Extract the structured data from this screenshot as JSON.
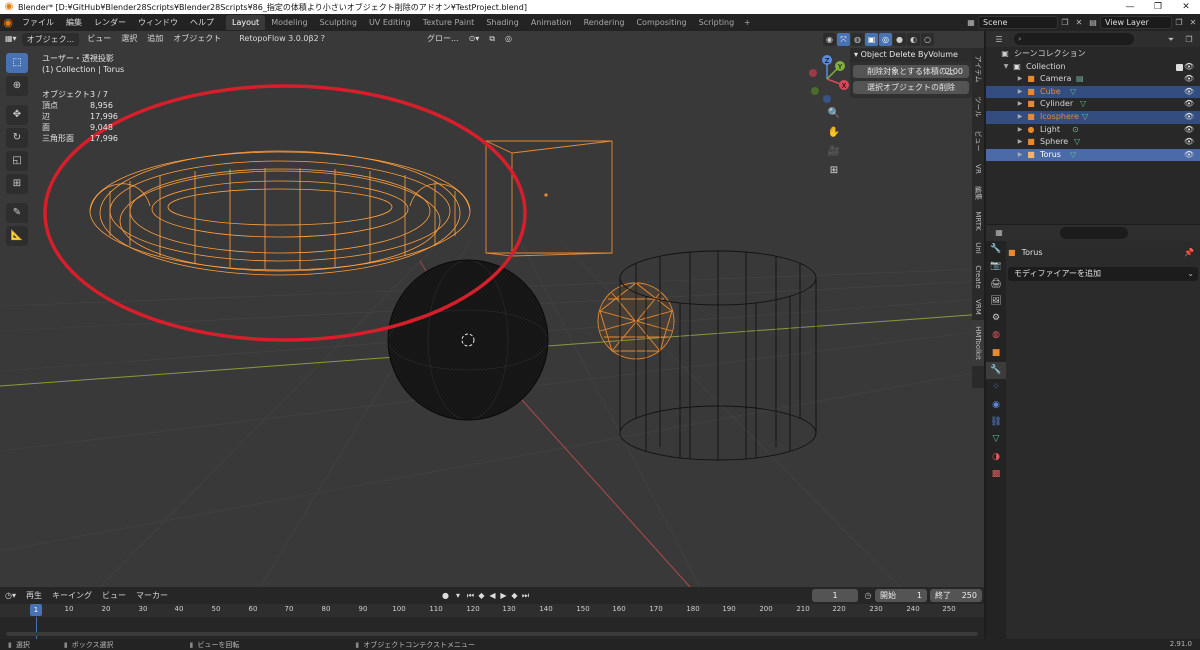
{
  "titlebar": {
    "title": "Blender* [D:¥GitHub¥Blender28Scripts¥Blender28Scripts¥86_指定の体積より小さいオブジェクト削除のアドオン¥TestProject.blend]",
    "minimize": "—",
    "maximize": "❐",
    "close": "✕"
  },
  "menubar": {
    "menus": [
      "ファイル",
      "編集",
      "レンダー",
      "ウィンドウ",
      "ヘルプ"
    ],
    "workspaces": [
      "Layout",
      "Modeling",
      "Sculpting",
      "UV Editing",
      "Texture Paint",
      "Shading",
      "Animation",
      "Rendering",
      "Compositing",
      "Scripting"
    ],
    "active_workspace": "Layout",
    "add_workspace": "+",
    "scene": "Scene",
    "view_layer": "View Layer"
  },
  "viewport_header": {
    "mode": "オブジェク...",
    "menus": [
      "ビュー",
      "選択",
      "追加",
      "オブジェクト"
    ],
    "addon": "RetopoFlow 3.0.0β2",
    "help": "?",
    "transform_orientation": "グロー...",
    "shading_modes": [
      "wireframe",
      "solid",
      "material",
      "rendered"
    ],
    "active_shading": "wireframe"
  },
  "overlay_info": {
    "view_name": "ユーザー・透視投影",
    "collection_info": "(1) Collection | Torus",
    "stats": [
      {
        "label": "オブジェクト",
        "value": "3 / 7"
      },
      {
        "label": "頂点",
        "value": "8,956"
      },
      {
        "label": "辺",
        "value": "17,996"
      },
      {
        "label": "面",
        "value": "9,048"
      },
      {
        "label": "三角形面",
        "value": "17,996"
      }
    ]
  },
  "gizmo": {
    "x": "X",
    "y": "Y",
    "z": "Z"
  },
  "npanel": {
    "title": "Object Delete ByVolume",
    "threshold_label": "削除対象とする体積の上",
    "threshold_value": "2.00",
    "delete_button": "選択オブジェクトの削除"
  },
  "sidebar_tabs": [
    "アイテム",
    "ツール",
    "ビュー",
    "VR",
    "編集",
    "MRTK",
    "UnI",
    "Create",
    "VRM",
    "HMToolkit"
  ],
  "timeline": {
    "menus": [
      "再生",
      "キーイング",
      "ビュー",
      "マーカー"
    ],
    "current_frame": "1",
    "start_label": "開始",
    "start": "1",
    "end_label": "終了",
    "end": "250",
    "ruler": [
      "10",
      "20",
      "30",
      "40",
      "50",
      "60",
      "70",
      "80",
      "90",
      "100",
      "110",
      "120",
      "130",
      "140",
      "150",
      "160",
      "170",
      "180",
      "190",
      "200",
      "210",
      "220",
      "230",
      "240",
      "250"
    ],
    "cursor": "1"
  },
  "statusbar": {
    "items": [
      "選択",
      "ボックス選択",
      "ビューを回転",
      "オブジェクトコンテクストメニュー"
    ],
    "version": "2.91.0"
  },
  "outliner": {
    "root": "シーンコレクション",
    "collection": "Collection",
    "objects": [
      {
        "name": "Camera",
        "selected": false,
        "color": "#d8d8d8"
      },
      {
        "name": "Cube",
        "selected": true,
        "color": "#e8892e"
      },
      {
        "name": "Cylinder",
        "selected": false,
        "color": "#d8d8d8"
      },
      {
        "name": "Icosphere",
        "selected": true,
        "color": "#e8892e"
      },
      {
        "name": "Light",
        "selected": false,
        "color": "#d8d8d8"
      },
      {
        "name": "Sphere",
        "selected": false,
        "color": "#d8d8d8"
      },
      {
        "name": "Torus",
        "selected": true,
        "color": "#e8e8e8"
      }
    ]
  },
  "properties": {
    "object_name": "Torus",
    "add_modifier": "モディファイアーを追加"
  },
  "colors": {
    "selected_wire": "#e8892e",
    "active_wire": "#ffb463",
    "annotation": "#d81e2a",
    "accent": "#4772b3"
  }
}
